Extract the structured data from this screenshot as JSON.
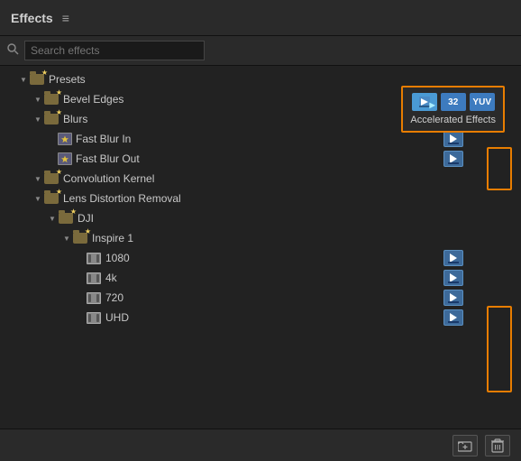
{
  "header": {
    "title": "Effects",
    "menu_icon": "≡"
  },
  "search": {
    "placeholder": "Search effects"
  },
  "accelerated_tooltip": {
    "label": "Accelerated Effects",
    "icon_32": "32",
    "icon_yuv": "YUV"
  },
  "tree": {
    "items": [
      {
        "id": "presets",
        "label": "Presets",
        "level": 0,
        "type": "folder-star",
        "expanded": true
      },
      {
        "id": "bevel-edges",
        "label": "Bevel Edges",
        "level": 1,
        "type": "folder-star",
        "expanded": true
      },
      {
        "id": "blurs",
        "label": "Blurs",
        "level": 1,
        "type": "folder-star",
        "expanded": true
      },
      {
        "id": "fast-blur-in",
        "label": "Fast Blur In",
        "level": 2,
        "type": "effect-star",
        "hasAccel": true
      },
      {
        "id": "fast-blur-out",
        "label": "Fast Blur Out",
        "level": 2,
        "type": "effect-star",
        "hasAccel": true
      },
      {
        "id": "convolution-kernel",
        "label": "Convolution Kernel",
        "level": 1,
        "type": "folder-star",
        "expanded": true
      },
      {
        "id": "lens-distortion-removal",
        "label": "Lens Distortion Removal",
        "level": 1,
        "type": "folder-star",
        "expanded": true
      },
      {
        "id": "dji",
        "label": "DJI",
        "level": 2,
        "type": "folder-star",
        "expanded": true
      },
      {
        "id": "inspire1",
        "label": "Inspire 1",
        "level": 3,
        "type": "folder-star",
        "expanded": true
      },
      {
        "id": "1080",
        "label": "1080",
        "level": 4,
        "type": "film",
        "hasAccel": true
      },
      {
        "id": "4k",
        "label": "4k",
        "level": 4,
        "type": "film",
        "hasAccel": true
      },
      {
        "id": "720",
        "label": "720",
        "level": 4,
        "type": "film",
        "hasAccel": true
      },
      {
        "id": "uhd",
        "label": "UHD",
        "level": 4,
        "type": "film",
        "hasAccel": true
      }
    ]
  },
  "bottom": {
    "new_folder_tooltip": "New Folder",
    "delete_tooltip": "Delete"
  }
}
